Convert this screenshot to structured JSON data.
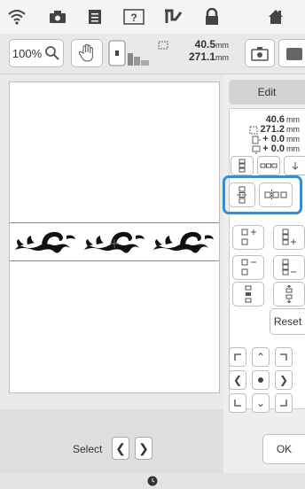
{
  "toolbar": {
    "icons": [
      "wifi-icon",
      "camera-icon",
      "document-icon",
      "help-icon",
      "thread-icon",
      "lock-icon",
      "home-icon"
    ]
  },
  "secbar": {
    "zoom_label": "100%",
    "width_value": "40.5",
    "height_value": "271.1",
    "unit": "mm"
  },
  "panel": {
    "edit_label": "Edit",
    "dims": {
      "width": "40.6",
      "height": "271.2",
      "offset_x": "+ 0.0",
      "offset_y": "+ 0.0",
      "unit": "mm"
    },
    "reset_label": "Reset",
    "ok_label": "OK"
  },
  "bottom": {
    "select_label": "Select"
  },
  "colors": {
    "highlight": "#2d8fe0"
  }
}
